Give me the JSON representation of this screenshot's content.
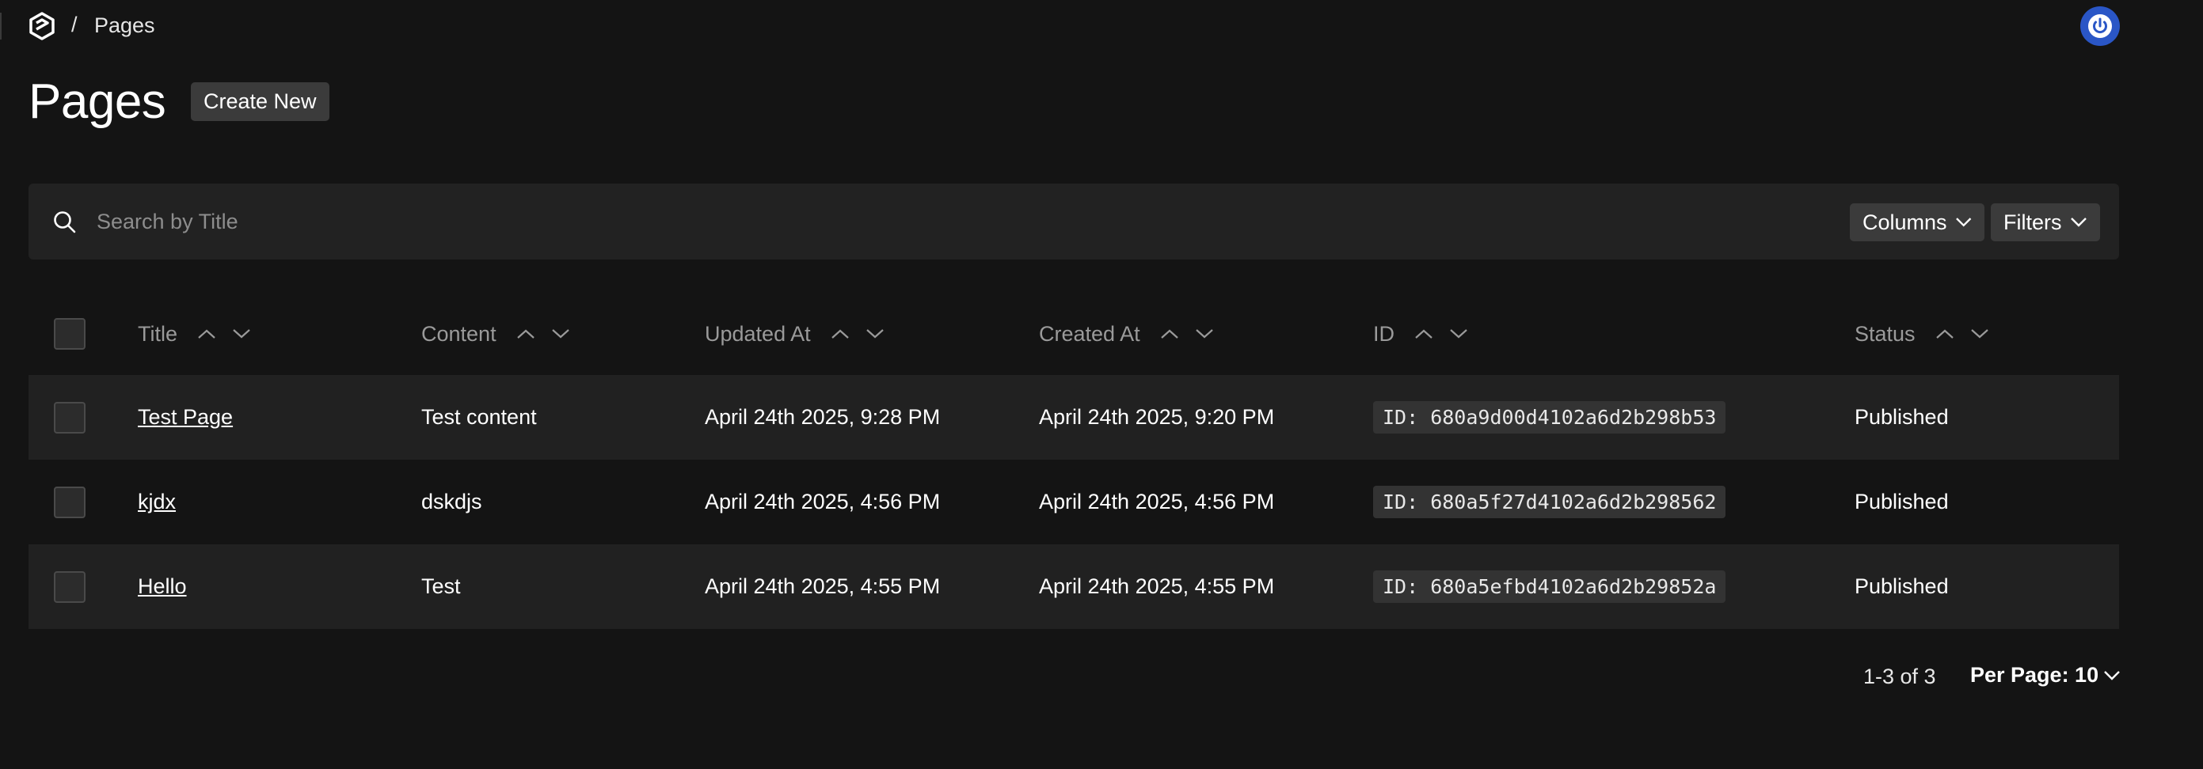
{
  "breadcrumb": {
    "separator": "/",
    "current": "Pages"
  },
  "header": {
    "title": "Pages",
    "create_label": "Create New"
  },
  "search": {
    "placeholder": "Search by Title",
    "value": ""
  },
  "toolbar": {
    "columns_label": "Columns",
    "filters_label": "Filters"
  },
  "table": {
    "columns": [
      "Title",
      "Content",
      "Updated At",
      "Created At",
      "ID",
      "Status"
    ],
    "rows": [
      {
        "title": "Test Page",
        "content": "Test content",
        "updated": "April 24th 2025, 9:28 PM",
        "created": "April 24th 2025, 9:20 PM",
        "id": "ID: 680a9d00d4102a6d2b298b53",
        "status": "Published"
      },
      {
        "title": "kjdx",
        "content": "dskdjs",
        "updated": "April 24th 2025, 4:56 PM",
        "created": "April 24th 2025, 4:56 PM",
        "id": "ID: 680a5f27d4102a6d2b298562",
        "status": "Published"
      },
      {
        "title": "Hello",
        "content": "Test",
        "updated": "April 24th 2025, 4:55 PM",
        "created": "April 24th 2025, 4:55 PM",
        "id": "ID: 680a5efbd4102a6d2b29852a",
        "status": "Published"
      }
    ]
  },
  "pagination": {
    "range": "1-3 of 3",
    "per_page": "Per Page: 10"
  },
  "colors": {
    "background": "#141414",
    "surface": "#222222",
    "button": "#3b3b3b",
    "account": "#2a56c6"
  }
}
